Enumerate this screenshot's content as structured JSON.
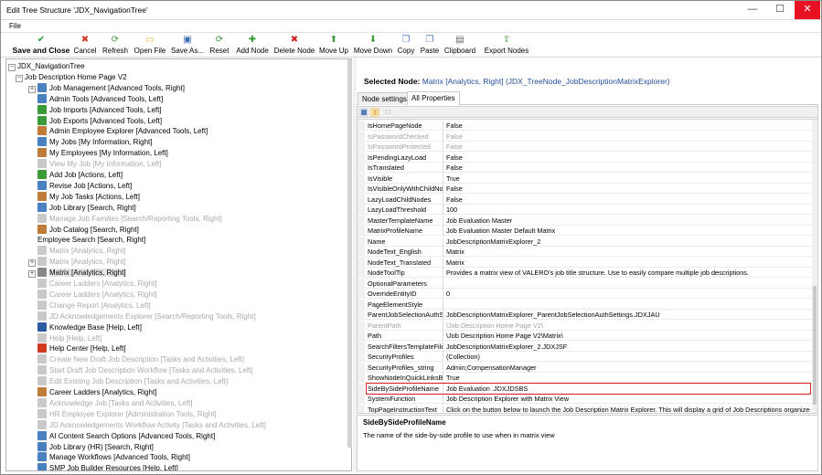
{
  "window": {
    "title": "Edit Tree Structure 'JDX_NavigationTree'"
  },
  "menu": {
    "file": "File"
  },
  "toolbar": {
    "buttons": [
      {
        "label": "Save and Close",
        "icon": "save-close-icon",
        "color": "#2f9e2f"
      },
      {
        "label": "Cancel",
        "icon": "cancel-icon",
        "color": "#d03a1e"
      },
      {
        "label": "Refresh",
        "icon": "refresh-icon",
        "color": "#3c9a3c"
      },
      {
        "label": "Open File",
        "icon": "open-file-icon",
        "color": "#e8b33e"
      },
      {
        "label": "Save As...",
        "icon": "save-as-icon",
        "color": "#3a6bb5"
      },
      {
        "label": "Reset",
        "icon": "reset-icon",
        "color": "#3c9a3c"
      },
      {
        "label": "Add Node",
        "icon": "add-node-icon",
        "color": "#3a9a3a"
      },
      {
        "label": "Delete Node",
        "icon": "delete-node-icon",
        "color": "#d02020"
      },
      {
        "label": "Move Up",
        "icon": "move-up-icon",
        "color": "#3a9a3a"
      },
      {
        "label": "Move Down",
        "icon": "move-down-icon",
        "color": "#3a9a3a"
      },
      {
        "label": "Copy",
        "icon": "copy-icon",
        "color": "#5b7fbf"
      },
      {
        "label": "Paste",
        "icon": "paste-icon",
        "color": "#5b7fbf"
      },
      {
        "label": "Clipboard",
        "icon": "clipboard-icon",
        "color": "#666666"
      },
      {
        "label": "Export Nodes",
        "icon": "export-nodes-icon",
        "color": "#3a9a3a"
      }
    ]
  },
  "tree": {
    "items": [
      {
        "label": "JDX_NavigationTree",
        "level": 0,
        "expander": "⊟",
        "icon": "none",
        "dim": false
      },
      {
        "label": "Job Description Home Page V2",
        "level": 1,
        "expander": "⊟",
        "icon": "none",
        "dim": false
      },
      {
        "label": "Job Management [Advanced Tools, Right]",
        "level": 2,
        "expander": "⊞",
        "icon": "#4a7fc0",
        "dim": false
      },
      {
        "label": "Admin Tools [Advanced Tools, Left]",
        "level": 2,
        "expander": "",
        "icon": "#4a7fc0",
        "dim": false
      },
      {
        "label": "Job Imports [Advanced Tools, Left]",
        "level": 2,
        "expander": "",
        "icon": "#3a9a3a",
        "dim": false
      },
      {
        "label": "Job Exports [Advanced Tools, Left]",
        "level": 2,
        "expander": "",
        "icon": "#3a9a3a",
        "dim": false
      },
      {
        "label": "Admin Employee Explorer [Advanced Tools, Left]",
        "level": 2,
        "expander": "",
        "icon": "#c07a3a",
        "dim": false
      },
      {
        "label": "My Jobs [My Information, Right]",
        "level": 2,
        "expander": "",
        "icon": "#4a7fc0",
        "dim": false
      },
      {
        "label": "My Employees [My Information, Left]",
        "level": 2,
        "expander": "",
        "icon": "#c07a3a",
        "dim": false
      },
      {
        "label": "View My Job [My Information, Left]",
        "level": 2,
        "expander": "",
        "icon": "#c9c9c9",
        "dim": true
      },
      {
        "label": "Add Job [Actions, Left]",
        "level": 2,
        "expander": "",
        "icon": "#3a9a3a",
        "dim": false
      },
      {
        "label": "Revise Job [Actions, Left]",
        "level": 2,
        "expander": "",
        "icon": "#4a7fc0",
        "dim": false
      },
      {
        "label": "My Job Tasks [Actions, Left]",
        "level": 2,
        "expander": "",
        "icon": "#c07a3a",
        "dim": false
      },
      {
        "label": "Job Library [Search, Right]",
        "level": 2,
        "expander": "",
        "icon": "#4a7fc0",
        "dim": false
      },
      {
        "label": "Manage Job Families [Search/Reporting Tools, Right]",
        "level": 2,
        "expander": "",
        "icon": "#c9c9c9",
        "dim": true
      },
      {
        "label": "Job Catalog [Search, Right]",
        "level": 2,
        "expander": "",
        "icon": "#c07a3a",
        "dim": false
      },
      {
        "label": "Employee Search [Search, Right]",
        "level": 2,
        "expander": "",
        "icon": "none",
        "dim": false
      },
      {
        "label": "Matrix [Analytics, Right]",
        "level": 2,
        "expander": "",
        "icon": "#c9c9c9",
        "dim": true
      },
      {
        "label": "Matrix [Analytics, Right]",
        "level": 2,
        "expander": "⊞",
        "icon": "#c9c9c9",
        "dim": true
      },
      {
        "label": "Matrix [Analytics, Right]",
        "level": 2,
        "expander": "⊞",
        "icon": "#888888",
        "dim": false,
        "selected": true
      },
      {
        "label": "Career Ladders [Analytics, Right]",
        "level": 2,
        "expander": "",
        "icon": "#c9c9c9",
        "dim": true
      },
      {
        "label": "Career Ladders [Analytics, Right]",
        "level": 2,
        "expander": "",
        "icon": "#c9c9c9",
        "dim": true
      },
      {
        "label": "Change Report [Analytics, Left]",
        "level": 2,
        "expander": "",
        "icon": "#c9c9c9",
        "dim": true
      },
      {
        "label": "JD Acknowledgements Explorer [Search/Reporting Tools, Right]",
        "level": 2,
        "expander": "",
        "icon": "#c9c9c9",
        "dim": true
      },
      {
        "label": "Knowledge Base [Help, Left]",
        "level": 2,
        "expander": "",
        "icon": "#2a5aa0",
        "dim": false
      },
      {
        "label": "Help [Help, Left]",
        "level": 2,
        "expander": "",
        "icon": "#c9c9c9",
        "dim": true
      },
      {
        "label": "Help Center [Help, Left]",
        "level": 2,
        "expander": "",
        "icon": "#d03a1e",
        "dim": false
      },
      {
        "label": "Create New Draft Job Description [Tasks and Activities, Left]",
        "level": 2,
        "expander": "",
        "icon": "#c9c9c9",
        "dim": true
      },
      {
        "label": "Start Draft Job Description Workflow [Tasks and Activities, Left]",
        "level": 2,
        "expander": "",
        "icon": "#c9c9c9",
        "dim": true
      },
      {
        "label": "Edit Existing Job Description [Tasks and Activities, Left]",
        "level": 2,
        "expander": "",
        "icon": "#c9c9c9",
        "dim": true
      },
      {
        "label": "Career Ladders [Analytics, Right]",
        "level": 2,
        "expander": "",
        "icon": "#c07a3a",
        "dim": false
      },
      {
        "label": "Acknowledge Job [Tasks and Activities, Left]",
        "level": 2,
        "expander": "",
        "icon": "#c9c9c9",
        "dim": true
      },
      {
        "label": "HR Employee Explorer [Administration Tools, Right]",
        "level": 2,
        "expander": "",
        "icon": "#c9c9c9",
        "dim": true
      },
      {
        "label": "JD Acknowledgements Workflow Activity [Tasks and Activities, Left]",
        "level": 2,
        "expander": "",
        "icon": "#c9c9c9",
        "dim": true
      },
      {
        "label": "AI Content Search Options [Advanced Tools, Right]",
        "level": 2,
        "expander": "",
        "icon": "#4a7fc0",
        "dim": false
      },
      {
        "label": "Job Library (HR) [Search, Right]",
        "level": 2,
        "expander": "",
        "icon": "#4a7fc0",
        "dim": false
      },
      {
        "label": "Manage Workflows [Advanced Tools, Right]",
        "level": 2,
        "expander": "",
        "icon": "#4a7fc0",
        "dim": false
      },
      {
        "label": "SMP Job Builder Resources [Help, Left]",
        "level": 2,
        "expander": "",
        "icon": "#4a7fc0",
        "dim": false
      }
    ]
  },
  "selected_node": {
    "label": "Selected Node:",
    "value": "Matrix [Analytics, Right] (JDX_TreeNode_JobDescriptionMatrixExplorer)"
  },
  "tabs": [
    {
      "label": "Node settings",
      "active": false
    },
    {
      "label": "All Properties",
      "active": true
    }
  ],
  "properties": [
    {
      "name": "IsHomePageNode",
      "value": "False",
      "ro": false
    },
    {
      "name": "IsPasswordChecked",
      "value": "False",
      "ro": true
    },
    {
      "name": "IsPasswordProtected",
      "value": "False",
      "ro": true
    },
    {
      "name": "IsPendingLazyLoad",
      "value": "False",
      "ro": false
    },
    {
      "name": "IsTranslated",
      "value": "False",
      "ro": false
    },
    {
      "name": "IsVisible",
      "value": "True",
      "ro": false
    },
    {
      "name": "IsVisibleOnlyWithChildNod",
      "value": "False",
      "ro": false
    },
    {
      "name": "LazyLoadChildNodes",
      "value": "False",
      "ro": false
    },
    {
      "name": "LazyLoadThreshold",
      "value": "100",
      "ro": false
    },
    {
      "name": "MasterTemplateName",
      "value": "Job Evaluation Master",
      "ro": false
    },
    {
      "name": "MatrixProfileName",
      "value": "Job Evaluation Master Default Matrix",
      "ro": false
    },
    {
      "name": "Name",
      "value": "JobDescriptionMatrixExplorer_2",
      "ro": false
    },
    {
      "name": "NodeText_English",
      "value": "Matrix",
      "ro": false
    },
    {
      "name": "NodeText_Translated",
      "value": "Matrix",
      "ro": false
    },
    {
      "name": "NodeToolTip",
      "value": "Provides a matrix view of VALERO's job title structure. Use to easily compare multiple job descriptions.",
      "ro": false
    },
    {
      "name": "OptionalParameters",
      "value": "",
      "ro": false
    },
    {
      "name": "OverrideEntityID",
      "value": "0",
      "ro": false
    },
    {
      "name": "PageElementStyle",
      "value": "",
      "ro": false
    },
    {
      "name": "ParentJobSelectionAuthSe",
      "value": "JobDescriptionMatrixExplorer_ParentJobSelectionAuthSettings.JDXJAU",
      "ro": false
    },
    {
      "name": "ParentPath",
      "value": "\\Job Description Home Page V2\\",
      "ro": true
    },
    {
      "name": "Path",
      "value": "\\Job Description Home Page V2\\Matrix\\",
      "ro": false
    },
    {
      "name": "SearchFiltersTemplateFile",
      "value": "JobDescriptionMatrixExplorer_2.JDXJSF",
      "ro": false
    },
    {
      "name": "SecurityProfiles",
      "value": "(Collection)",
      "ro": false
    },
    {
      "name": "SecurityProfiles_string",
      "value": "Admin;CompensationManager",
      "ro": false
    },
    {
      "name": "ShowNodeInQuickLinksBo",
      "value": "True",
      "ro": false
    },
    {
      "name": "SideBySideProfileName",
      "value": "Job Evaluation .JDXJDSBS",
      "ro": false
    },
    {
      "name": "SystemFunction",
      "value": "Job Description Explorer with Matrix View",
      "ro": false
    },
    {
      "name": "TopPageInstructionText",
      "value": "Click on the button below to launch the Job Description Matrix Explorer. This will display a grid of Job Descriptions organized by Jo...",
      "ro": false
    }
  ],
  "description": {
    "title": "SideBySideProfileName",
    "text": "The name of the side-by-side profile to use when in matrix view"
  },
  "colors": {
    "highlight": "#e0202a",
    "selected_value": "#1f4e9c"
  }
}
